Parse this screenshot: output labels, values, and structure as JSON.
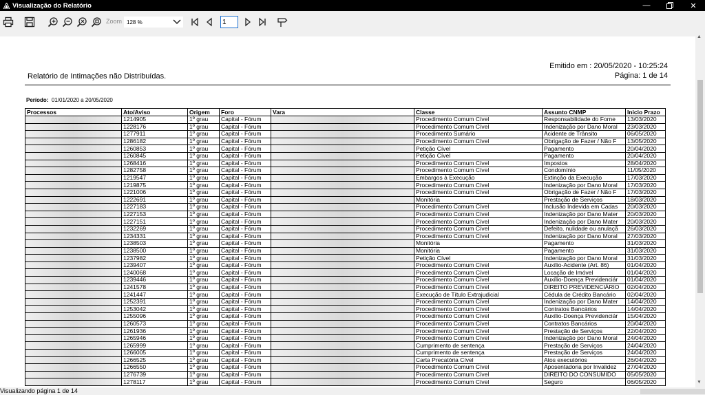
{
  "window": {
    "title": "Visualização do Relatório"
  },
  "toolbar": {
    "zoom_label": "Zoom",
    "zoom_value": "128 %",
    "page_value": "1"
  },
  "report": {
    "emitted": "Emitido em : 20/05/2020 - 10:25:24",
    "page_info": "Página: 1 de 14",
    "title": "Relatório de Intimações não Distribuídas.",
    "period_label": "Período:",
    "period_value": "01/01/2020 a 20/05/2020",
    "columns": [
      "Processos",
      "Ato/Aviso",
      "Origem",
      "Foro",
      "Vara",
      "Classe",
      "Assunto CNMP",
      "Inicio Prazo"
    ],
    "rows": [
      [
        "1214905",
        "1º grau",
        "Capital - Fórum",
        "Procedimento Comum Cível",
        "Responsabilidade do Forne",
        "13/03/2020"
      ],
      [
        "1228176",
        "1º grau",
        "Capital - Fórum",
        "Procedimento Comum Cível",
        "Indenização por Dano Moral",
        "23/03/2020"
      ],
      [
        "1277911",
        "1º grau",
        "Capital - Fórum",
        "Procedimento Sumário",
        "Acidente de Trânsito",
        "06/05/2020"
      ],
      [
        "1286182",
        "1º grau",
        "Capital - Fórum",
        "Procedimento Comum Cível",
        "Obrigação de Fazer / Não F",
        "13/05/2020"
      ],
      [
        "1260853",
        "1º grau",
        "Capital - Fórum",
        "Petição Cível",
        "Pagamento",
        "20/04/2020"
      ],
      [
        "1260845",
        "1º grau",
        "Capital - Fórum",
        "Petição Cível",
        "Pagamento",
        "20/04/2020"
      ],
      [
        "1268416",
        "1º grau",
        "Capital - Fórum",
        "Procedimento Comum Cível",
        "Impostos",
        "28/04/2020"
      ],
      [
        "1282758",
        "1º grau",
        "Capital - Fórum",
        "Procedimento Comum Cível",
        "Condomínio",
        "11/05/2020"
      ],
      [
        "1219547",
        "1º grau",
        "Capital - Fórum",
        "Embargos à Execução",
        "Extinção da Execução",
        "17/03/2020"
      ],
      [
        "1219875",
        "1º grau",
        "Capital - Fórum",
        "Procedimento Comum Cível",
        "Indenização por Dano Moral",
        "17/03/2020"
      ],
      [
        "1221006",
        "1º grau",
        "Capital - Fórum",
        "Procedimento Comum Cível",
        "Obrigação de Fazer / Não F",
        "17/03/2020"
      ],
      [
        "1222691",
        "1º grau",
        "Capital - Fórum",
        "Monitória",
        "Prestação de Serviços",
        "18/03/2020"
      ],
      [
        "1227183",
        "1º grau",
        "Capital - Fórum",
        "Procedimento Comum Cível",
        "Inclusão Indevida em Cadas",
        "20/03/2020"
      ],
      [
        "1227153",
        "1º grau",
        "Capital - Fórum",
        "Procedimento Comum Cível",
        "Indenização por Dano Mater",
        "20/03/2020"
      ],
      [
        "1227151",
        "1º grau",
        "Capital - Fórum",
        "Procedimento Comum Cível",
        "Indenização por Dano Mater",
        "20/03/2020"
      ],
      [
        "1232269",
        "1º grau",
        "Capital - Fórum",
        "Procedimento Comum Cível",
        "Defeito, nulidade ou anulaçã",
        "26/03/2020"
      ],
      [
        "1234331",
        "1º grau",
        "Capital - Fórum",
        "Procedimento Comum Cível",
        "Indenização por Dano Moral",
        "27/03/2020"
      ],
      [
        "1238503",
        "1º grau",
        "Capital - Fórum",
        "Monitória",
        "Pagamento",
        "31/03/2020"
      ],
      [
        "1238500",
        "1º grau",
        "Capital - Fórum",
        "Monitória",
        "Pagamento",
        "31/03/2020"
      ],
      [
        "1237982",
        "1º grau",
        "Capital - Fórum",
        "Petição Cível",
        "Indenização por Dano Moral",
        "31/03/2020"
      ],
      [
        "1239407",
        "1º grau",
        "Capital - Fórum",
        "Procedimento Comum Cível",
        "Auxílio-Acidente (Art. 86)",
        "01/04/2020"
      ],
      [
        "1240068",
        "1º grau",
        "Capital - Fórum",
        "Procedimento Comum Cível",
        "Locação de Imóvel",
        "01/04/2020"
      ],
      [
        "1239446",
        "1º grau",
        "Capital - Fórum",
        "Procedimento Comum Cível",
        "Auxílio-Doença Previdenciár",
        "01/04/2020"
      ],
      [
        "1241578",
        "1º grau",
        "Capital - Fórum",
        "Procedimento Comum Cível",
        "DIREITO PREVIDENCIÁRIO",
        "02/04/2020"
      ],
      [
        "1241447",
        "1º grau",
        "Capital - Fórum",
        "Execução de Título Extrajudicial",
        "Cédula de Crédito Bancário",
        "02/04/2020"
      ],
      [
        "1252391",
        "1º grau",
        "Capital - Fórum",
        "Procedimento Comum Cível",
        "Indenização por Dano Mater",
        "14/04/2020"
      ],
      [
        "1253042",
        "1º grau",
        "Capital - Fórum",
        "Procedimento Comum Cível",
        "Contratos Bancários",
        "14/04/2020"
      ],
      [
        "1255096",
        "1º grau",
        "Capital - Fórum",
        "Procedimento Comum Cível",
        "Auxílio-Doença Previdenciár",
        "15/04/2020"
      ],
      [
        "1260573",
        "1º grau",
        "Capital - Fórum",
        "Procedimento Comum Cível",
        "Contratos Bancários",
        "20/04/2020"
      ],
      [
        "1261936",
        "1º grau",
        "Capital - Fórum",
        "Procedimento Comum Cível",
        "Prestação de Serviços",
        "22/04/2020"
      ],
      [
        "1265946",
        "1º grau",
        "Capital - Fórum",
        "Procedimento Comum Cível",
        "Indenização por Dano Moral",
        "24/04/2020"
      ],
      [
        "1265999",
        "1º grau",
        "Capital - Fórum",
        "Cumprimento de sentença",
        "Prestação de Serviços",
        "24/04/2020"
      ],
      [
        "1266005",
        "1º grau",
        "Capital - Fórum",
        "Cumprimento de sentença",
        "Prestação de Serviços",
        "24/04/2020"
      ],
      [
        "1266525",
        "1º grau",
        "Capital - Fórum",
        "Carta Precatória Cível",
        "Atos executórios",
        "26/04/2020"
      ],
      [
        "1266550",
        "1º grau",
        "Capital - Fórum",
        "Procedimento Comum Cível",
        "Aposentadoria por Invalidez",
        "27/04/2020"
      ],
      [
        "1276739",
        "1º grau",
        "Capital - Fórum",
        "Procedimento Comum Cível",
        "DIREITO DO CONSUMIDO",
        "05/05/2020"
      ],
      [
        "1278117",
        "1º grau",
        "Capital - Fórum",
        "Procedimento Comum Cível",
        "Seguro",
        "06/05/2020"
      ]
    ]
  },
  "statusbar": {
    "text": "Visualizando página 1 de 14"
  }
}
